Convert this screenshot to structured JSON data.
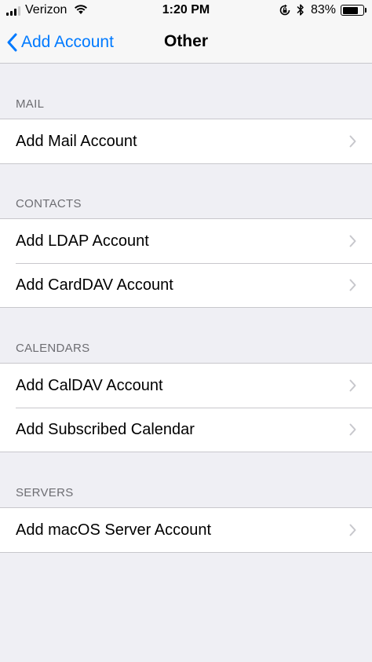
{
  "status_bar": {
    "carrier": "Verizon",
    "time": "1:20 PM",
    "battery_percent": "83%",
    "battery_level": 0.83,
    "icons": [
      "signal-icon",
      "wifi-icon",
      "rotation-lock-icon",
      "bluetooth-icon",
      "battery-icon"
    ]
  },
  "nav": {
    "back_label": "Add Account",
    "title": "Other"
  },
  "sections": [
    {
      "header": "MAIL",
      "items": [
        {
          "label": "Add Mail Account"
        }
      ]
    },
    {
      "header": "CONTACTS",
      "items": [
        {
          "label": "Add LDAP Account"
        },
        {
          "label": "Add CardDAV Account"
        }
      ]
    },
    {
      "header": "CALENDARS",
      "items": [
        {
          "label": "Add CalDAV Account"
        },
        {
          "label": "Add Subscribed Calendar"
        }
      ]
    },
    {
      "header": "SERVERS",
      "items": [
        {
          "label": "Add macOS Server Account"
        }
      ]
    }
  ],
  "colors": {
    "accent": "#007aff",
    "background": "#efeff4",
    "separator": "#c8c7cc",
    "chevron": "#c7c7cc",
    "header_text": "#6d6d72"
  }
}
